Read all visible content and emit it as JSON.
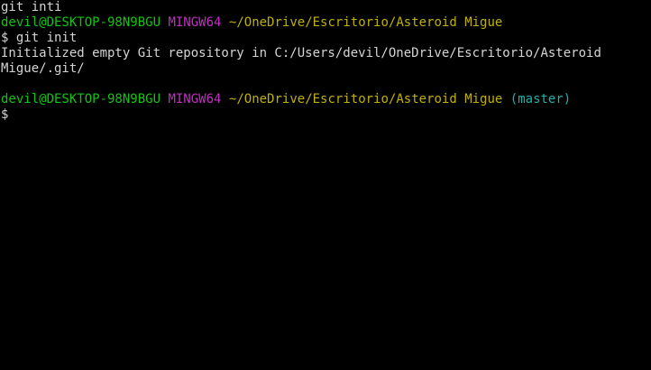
{
  "terminal": {
    "lines": [
      {
        "text": "git inti"
      },
      {
        "user": "devil@DESKTOP-98N9BGU",
        "env": "MINGW64",
        "path": "~/OneDrive/Escritorio/Asteroid Migue"
      },
      {
        "text": "$ git init"
      },
      {
        "text": "Initialized empty Git repository in C:/Users/devil/OneDrive/Escritorio/Asteroid"
      },
      {
        "text": "Migue/.git/"
      },
      {
        "text": ""
      },
      {
        "user": "devil@DESKTOP-98N9BGU",
        "env": "MINGW64",
        "path": "~/OneDrive/Escritorio/Asteroid Migue",
        "branch": "(master)"
      },
      {
        "text": "$"
      }
    ]
  },
  "colors": {
    "background": "#000000",
    "text": "#d4d4d4",
    "user": "#13c313",
    "env": "#c030c0",
    "path": "#c0b000",
    "branch": "#20b2aa"
  }
}
